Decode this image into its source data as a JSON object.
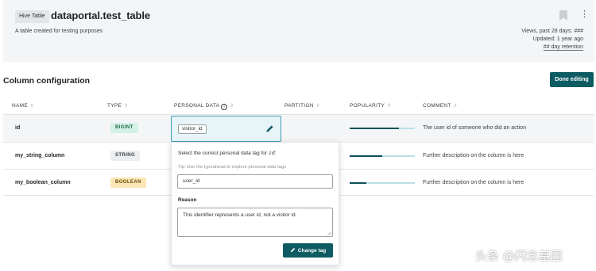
{
  "header": {
    "badge": "Hive Table",
    "title": "dataportal.test_table",
    "description": "A table created for testing purposes",
    "views": "Views, past 28 days: ###",
    "updated": "Updated: 1 year ago",
    "retention": "## day retention"
  },
  "section": {
    "title": "Column configuration",
    "done_button": "Done editing"
  },
  "columns": [
    "NAME",
    "TYPE",
    "PERSONAL DATA",
    "PARTITION",
    "POPULARITY",
    "COMMENT"
  ],
  "rows": [
    {
      "name": "id",
      "type": "BIGINT",
      "personal_data": "visitor_id",
      "popularity": 0.75,
      "comment": "The user id of someone who did an action"
    },
    {
      "name": "my_string_column",
      "type": "STRING",
      "personal_data": "",
      "popularity": 0.5,
      "comment": "Further description on the column is here"
    },
    {
      "name": "my_boolean_column",
      "type": "BOOLEAN",
      "personal_data": "",
      "popularity": 0.25,
      "comment": "Further description on the column is here"
    }
  ],
  "popover": {
    "question_prefix": "Select the correct personal data tag for ",
    "question_field": "id",
    "question_suffix": ":",
    "tip": "Tip: Use the typeahead to explore personal data tags",
    "input_value": "user_id",
    "reason_label": "Reason",
    "reason_text": "This identifier represents a user id, not a visitor id.",
    "change_button": "Change tag"
  },
  "watermark": "头条 @闪念基因",
  "icons": {
    "bookmark": "bookmark-icon",
    "more": "more-vertical-icon",
    "info": "info-icon",
    "sort": "sort-icon",
    "pencil": "pencil-icon"
  },
  "colors": {
    "primary": "#0e5c63",
    "header_bg": "#f4f5f6",
    "bigint_bg": "#d5f0e5",
    "boolean_bg": "#fbe7b5",
    "popularity_fill": "#0e4f5a",
    "popularity_track": "#b9dfe6"
  }
}
